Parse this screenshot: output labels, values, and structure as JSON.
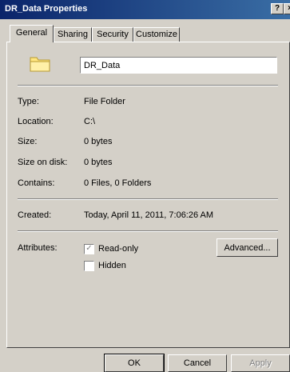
{
  "window": {
    "title": "DR_Data Properties",
    "help_glyph": "?",
    "close_glyph": "×"
  },
  "tabs": [
    "General",
    "Sharing",
    "Security",
    "Customize"
  ],
  "general": {
    "folder_name": "DR_Data",
    "rows": [
      {
        "label": "Type:",
        "value": "File Folder"
      },
      {
        "label": "Location:",
        "value": "C:\\"
      },
      {
        "label": "Size:",
        "value": "0 bytes"
      },
      {
        "label": "Size on disk:",
        "value": "0 bytes"
      },
      {
        "label": "Contains:",
        "value": "0 Files, 0 Folders"
      }
    ],
    "created": {
      "label": "Created:",
      "value": "Today, April 11, 2011, 7:06:26 AM"
    },
    "attributes": {
      "label": "Attributes:",
      "readonly": {
        "label": "Read-only",
        "checked": true,
        "glyph": "✓"
      },
      "hidden": {
        "label": "Hidden",
        "checked": false
      },
      "advanced_label": "Advanced..."
    }
  },
  "buttons": {
    "ok": "OK",
    "cancel": "Cancel",
    "apply": "Apply"
  },
  "colors": {
    "titlebar": "#0a246a",
    "face": "#d4d0c8",
    "folder": "#ffe680"
  }
}
